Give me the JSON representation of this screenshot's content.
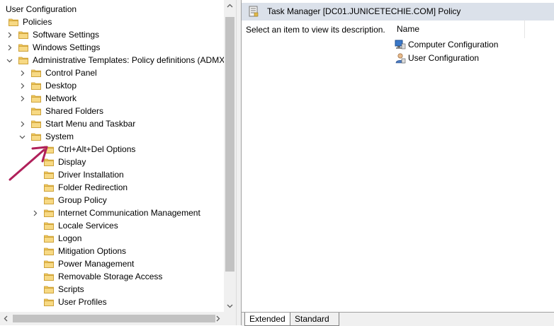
{
  "tree": {
    "items": [
      {
        "label": "User Configuration",
        "level": 0,
        "expander": "",
        "icon": "user-config-icon"
      },
      {
        "label": "Policies",
        "level": 0,
        "expander": "",
        "icon": "folder-icon"
      },
      {
        "label": "Software Settings",
        "level": 1,
        "expander": "collapsed",
        "icon": "folder-icon"
      },
      {
        "label": "Windows Settings",
        "level": 1,
        "expander": "collapsed",
        "icon": "folder-icon"
      },
      {
        "label": "Administrative Templates: Policy definitions (ADMX",
        "level": 1,
        "expander": "expanded",
        "icon": "folder-icon"
      },
      {
        "label": "Control Panel",
        "level": 2,
        "expander": "collapsed",
        "icon": "folder-icon"
      },
      {
        "label": "Desktop",
        "level": 2,
        "expander": "collapsed",
        "icon": "folder-icon"
      },
      {
        "label": "Network",
        "level": 2,
        "expander": "collapsed",
        "icon": "folder-icon"
      },
      {
        "label": "Shared Folders",
        "level": 2,
        "expander": "",
        "icon": "folder-icon"
      },
      {
        "label": "Start Menu and Taskbar",
        "level": 2,
        "expander": "collapsed",
        "icon": "folder-icon"
      },
      {
        "label": "System",
        "level": 2,
        "expander": "expanded",
        "icon": "folder-icon"
      },
      {
        "label": "Ctrl+Alt+Del Options",
        "level": 3,
        "expander": "",
        "icon": "folder-icon"
      },
      {
        "label": "Display",
        "level": 3,
        "expander": "",
        "icon": "folder-icon"
      },
      {
        "label": "Driver Installation",
        "level": 3,
        "expander": "",
        "icon": "folder-icon"
      },
      {
        "label": "Folder Redirection",
        "level": 3,
        "expander": "",
        "icon": "folder-icon"
      },
      {
        "label": "Group Policy",
        "level": 3,
        "expander": "",
        "icon": "folder-icon"
      },
      {
        "label": "Internet Communication Management",
        "level": 3,
        "expander": "collapsed",
        "icon": "folder-icon"
      },
      {
        "label": "Locale Services",
        "level": 3,
        "expander": "",
        "icon": "folder-icon"
      },
      {
        "label": "Logon",
        "level": 3,
        "expander": "",
        "icon": "folder-icon"
      },
      {
        "label": "Mitigation Options",
        "level": 3,
        "expander": "",
        "icon": "folder-icon"
      },
      {
        "label": "Power Management",
        "level": 3,
        "expander": "",
        "icon": "folder-icon"
      },
      {
        "label": "Removable Storage Access",
        "level": 3,
        "expander": "",
        "icon": "folder-icon"
      },
      {
        "label": "Scripts",
        "level": 3,
        "expander": "",
        "icon": "folder-icon"
      },
      {
        "label": "User Profiles",
        "level": 3,
        "expander": "",
        "icon": "folder-icon"
      }
    ]
  },
  "right": {
    "header_title": "Task Manager [DC01.JUNICETECHIE.COM] Policy",
    "description": "Select an item to view its description.",
    "column_name": "Name",
    "list": [
      {
        "label": "Computer Configuration",
        "icon": "computer-config-icon"
      },
      {
        "label": "User Configuration",
        "icon": "user-config-icon"
      }
    ]
  },
  "tabs": [
    {
      "label": "Extended",
      "active": true
    },
    {
      "label": "Standard",
      "active": false
    }
  ],
  "colors": {
    "folder": "#f0c85a",
    "header_band": "#dbe1ea",
    "annotation_arrow": "#b0205a"
  }
}
